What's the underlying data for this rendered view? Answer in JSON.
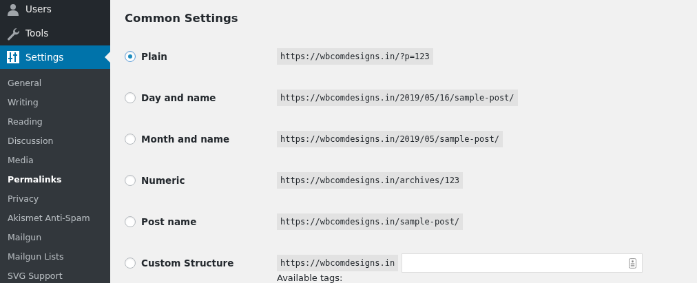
{
  "sidebar": {
    "items": [
      {
        "label": "Users",
        "kind": "user",
        "selected": false
      },
      {
        "label": "Tools",
        "kind": "wrench",
        "selected": false
      },
      {
        "label": "Settings",
        "kind": "sliders",
        "selected": true
      }
    ],
    "submenu": [
      {
        "label": "General",
        "selected": false
      },
      {
        "label": "Writing",
        "selected": false
      },
      {
        "label": "Reading",
        "selected": false
      },
      {
        "label": "Discussion",
        "selected": false
      },
      {
        "label": "Media",
        "selected": false
      },
      {
        "label": "Permalinks",
        "selected": true
      },
      {
        "label": "Privacy",
        "selected": false
      },
      {
        "label": "Akismet Anti-Spam",
        "selected": false
      },
      {
        "label": "Mailgun",
        "selected": false
      },
      {
        "label": "Mailgun Lists",
        "selected": false
      },
      {
        "label": "SVG Support",
        "selected": false
      }
    ]
  },
  "main": {
    "title": "Common Settings",
    "options": [
      {
        "kind": "preset",
        "label": "Plain",
        "url": "https://wbcomdesigns.in/?p=123",
        "selected": true
      },
      {
        "kind": "preset",
        "label": "Day and name",
        "url": "https://wbcomdesigns.in/2019/05/16/sample-post/",
        "selected": false
      },
      {
        "kind": "preset",
        "label": "Month and name",
        "url": "https://wbcomdesigns.in/2019/05/sample-post/",
        "selected": false
      },
      {
        "kind": "preset",
        "label": "Numeric",
        "url": "https://wbcomdesigns.in/archives/123",
        "selected": false
      },
      {
        "kind": "preset",
        "label": "Post name",
        "url": "https://wbcomdesigns.in/sample-post/",
        "selected": false
      },
      {
        "kind": "custom",
        "label": "Custom Structure",
        "url": "https://wbcomdesigns.in",
        "selected": false
      }
    ],
    "tags_label": "Available tags:"
  }
}
